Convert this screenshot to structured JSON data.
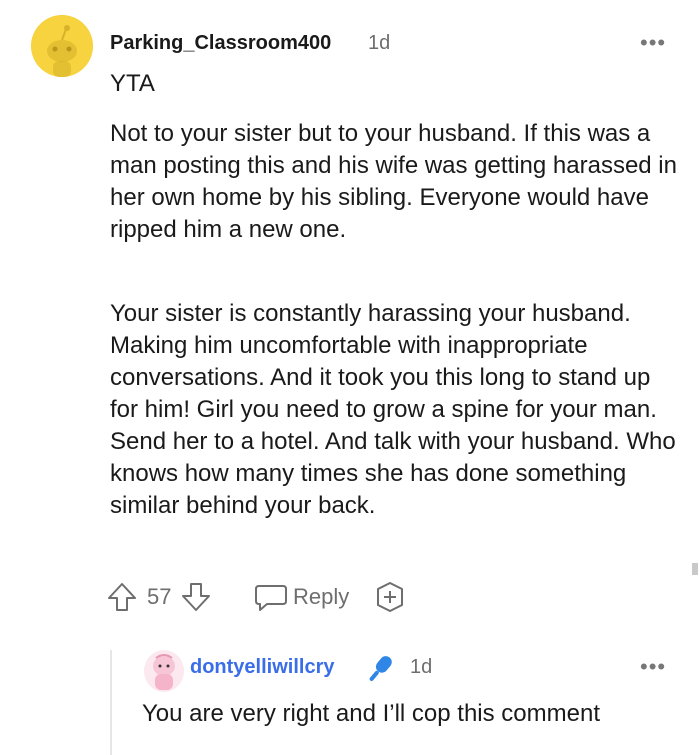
{
  "comment": {
    "username": "Parking_Classroom400",
    "age": "1d",
    "more_label": "•••",
    "verdict": "YTA",
    "paragraphs": [
      "Not to your sister but to your husband. If this was a man posting this and his wife was getting harassed in her own home by his sibling. Everyone would have ripped him a new one.",
      "Your sister is constantly harassing your husband. Making him uncomfortable with inappropriate conversations. And it took you this long to stand up for him! Girl you need to grow a spine for your man. Send her to a hotel. And talk with your husband. Who knows how many times she has done something similar behind your back."
    ],
    "votes": "57",
    "reply_label": "Reply",
    "avatar_icon": "snoo-avatar-icon",
    "upvote_icon": "upvote-arrow-icon",
    "downvote_icon": "downvote-arrow-icon",
    "reply_icon": "speech-bubble-icon",
    "award_icon": "award-plus-icon"
  },
  "reply": {
    "username": "dontyelliwillcry",
    "age": "1d",
    "more_label": "•••",
    "text": "You are very right and I’ll cop this comment",
    "flair_icon": "microphone-icon",
    "avatar_icon": "pink-character-avatar-icon"
  },
  "colors": {
    "avatar_bg": "#f7d33f",
    "username_link": "#3a6ee8",
    "mic_blue": "#2f86e6",
    "meta_gray": "#6e6e6e"
  }
}
